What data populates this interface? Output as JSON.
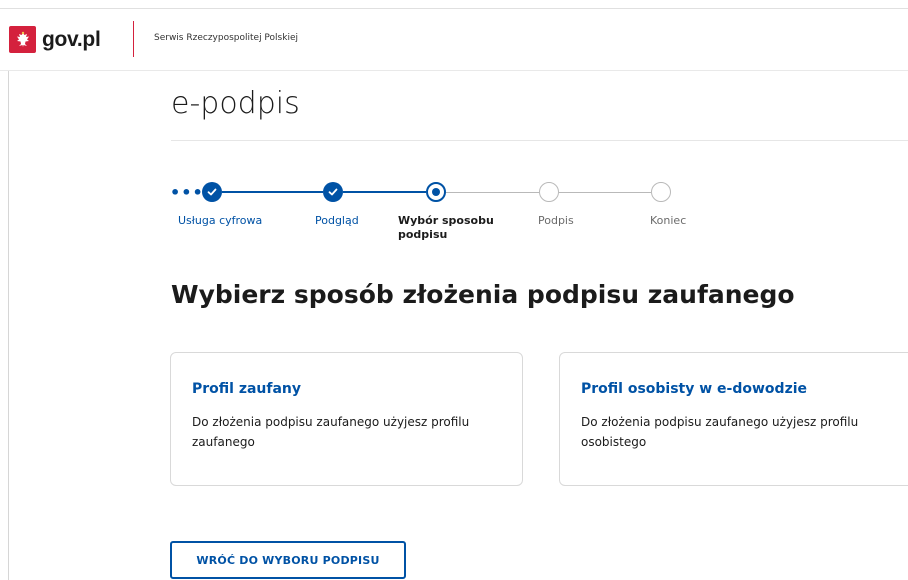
{
  "header": {
    "logo_text": "gov.pl",
    "service_name": "Serwis Rzeczypospolitej Polskiej"
  },
  "page": {
    "title": "e-podpis"
  },
  "stepper": {
    "more_indicator": "•••",
    "steps": [
      {
        "label": "Usługa cyfrowa",
        "state": "done"
      },
      {
        "label": "Podgląd",
        "state": "done"
      },
      {
        "label_line1": "Wybór sposobu",
        "label_line2": "podpisu",
        "state": "current"
      },
      {
        "label": "Podpis",
        "state": "todo"
      },
      {
        "label": "Koniec",
        "state": "todo"
      }
    ]
  },
  "main": {
    "heading": "Wybierz sposób złożenia podpisu zaufanego",
    "options": [
      {
        "title": "Profil zaufany",
        "description": "Do złożenia podpisu zaufanego użyjesz profilu zaufanego"
      },
      {
        "title": "Profil osobisty w e-dowodzie",
        "description": "Do złożenia podpisu zaufanego użyjesz profilu osobistego"
      }
    ],
    "back_button": "WRÓĆ DO WYBORU PODPISU"
  },
  "colors": {
    "accent": "#0052a5",
    "brand_red": "#d4213d",
    "border": "#d9d9d9"
  }
}
